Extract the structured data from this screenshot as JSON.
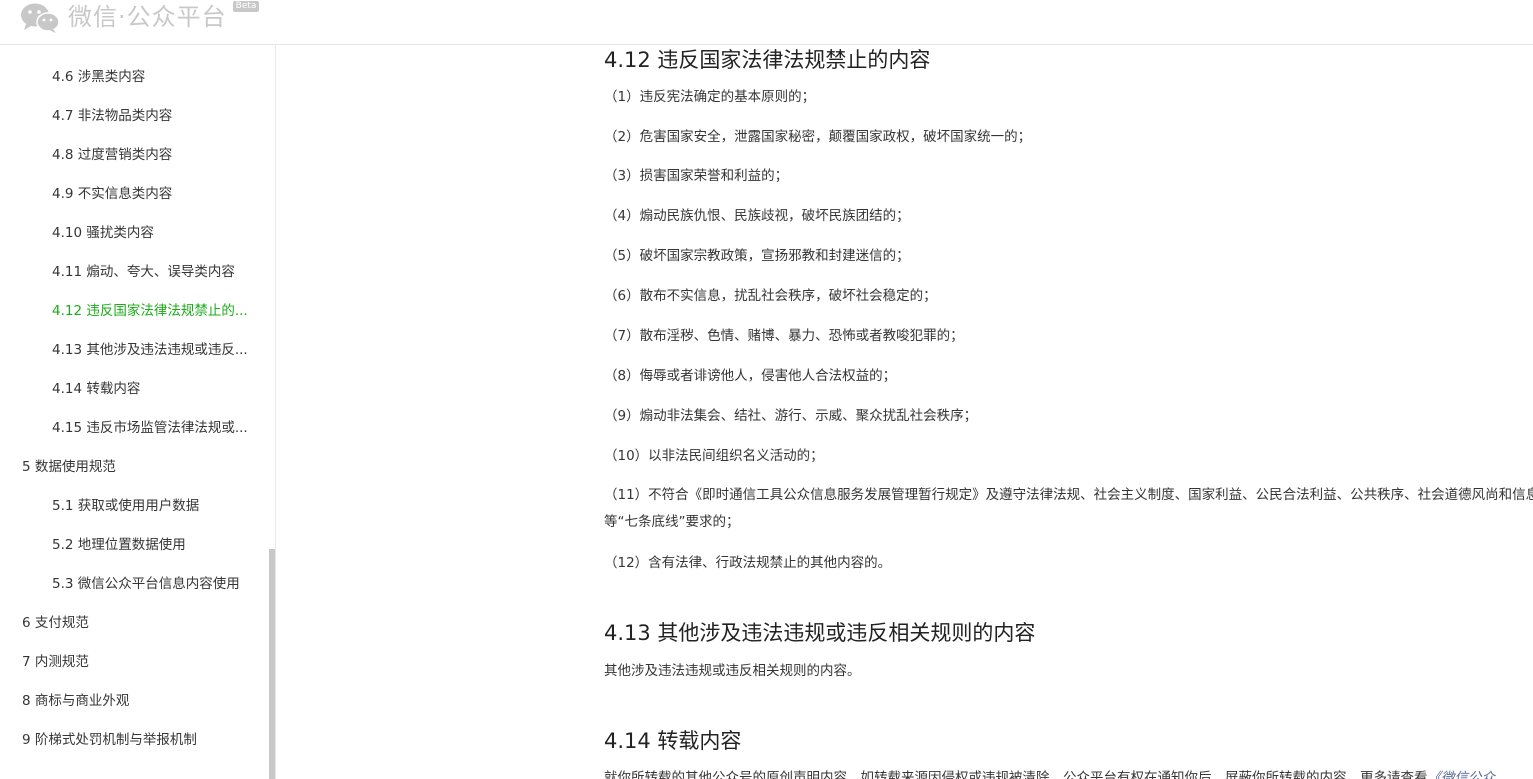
{
  "header": {
    "logo_text": "微信·公众平台",
    "beta": "Beta"
  },
  "sidebar": {
    "items": [
      {
        "label": "4.6 涉黑类内容"
      },
      {
        "label": "4.7 非法物品类内容"
      },
      {
        "label": "4.8 过度营销类内容"
      },
      {
        "label": "4.9 不实信息类内容"
      },
      {
        "label": "4.10 骚扰类内容"
      },
      {
        "label": "4.11 煽动、夸大、误导类内容"
      },
      {
        "label": "4.12 违反国家法律法规禁止的..."
      },
      {
        "label": "4.13 其他涉及违法违规或违反..."
      },
      {
        "label": "4.14 转载内容"
      },
      {
        "label": "4.15 违反市场监管法律法规或..."
      },
      {
        "label": "5 数据使用规范"
      },
      {
        "label": "5.1 获取或使用用户数据"
      },
      {
        "label": "5.2 地理位置数据使用"
      },
      {
        "label": "5.3 微信公众平台信息内容使用"
      },
      {
        "label": "6 支付规范"
      },
      {
        "label": "7 内测规范"
      },
      {
        "label": "8 商标与商业外观"
      },
      {
        "label": "9 阶梯式处罚机制与举报机制"
      }
    ]
  },
  "content": {
    "section_412": {
      "title": "4.12 违反国家法律法规禁止的内容",
      "items": [
        "（1）违反宪法确定的基本原则的；",
        "（2）危害国家安全，泄露国家秘密，颠覆国家政权，破坏国家统一的；",
        "（3）损害国家荣誉和利益的；",
        "（4）煽动民族仇恨、民族歧视，破坏民族团结的；",
        "（5）破坏国家宗教政策，宣扬邪教和封建迷信的；",
        "（6）散布不实信息，扰乱社会秩序，破坏社会稳定的；",
        "（7）散布淫秽、色情、赌博、暴力、恐怖或者教唆犯罪的；",
        "（8）侮辱或者诽谤他人，侵害他人合法权益的；",
        "（9）煽动非法集会、结社、游行、示威、聚众扰乱社会秩序；",
        "（10）以非法民间组织名义活动的；"
      ],
      "item_11": "（11）不符合《即时通信工具公众信息服务发展管理暂行规定》及遵守法律法规、社会主义制度、国家利益、公民合法利益、公共秩序、社会道德风尚和信息真实性等“七条底线”要求的；",
      "item_12": "（12）含有法律、行政法规禁止的其他内容的。"
    },
    "section_413": {
      "title": "4.13 其他涉及违法违规或违反相关规则的内容",
      "text": "其他涉及违法违规或违反相关规则的内容。"
    },
    "section_414": {
      "title": "4.14 转载内容",
      "text": "就你所转载的其他公众号的原创声明内容，如转载来源因侵权或违规被清除，公众平台有权在通知你后，屏蔽你所转载的内容。更多请查看",
      "link": "《微信公众"
    }
  }
}
